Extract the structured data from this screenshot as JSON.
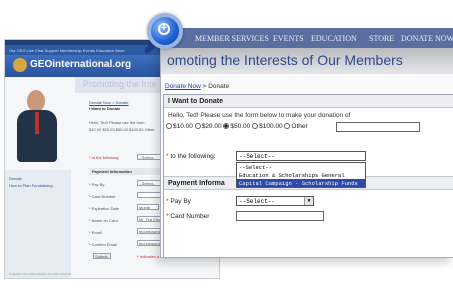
{
  "background_page": {
    "nav_text": "Our CEO Live Chat Support Membership Events Education Store",
    "logo_text": "GEOinternational.org",
    "title_text": "Promoting the Inte",
    "sidebar": [
      "Donate",
      "How to Plan Fundraising"
    ],
    "form": {
      "crumb": "Donate Now > Donate",
      "heading": "I Want to Donate",
      "greeting": "Hello, Ted! Please use the form",
      "amounts": "$10.00  $20.00  $50.00  $100.00  Other",
      "to_label": "* to the following:",
      "to_value": "--Select--",
      "payment_heading": "Payment Information",
      "fields": [
        {
          "label": "* Pay By",
          "value": "--Select--"
        },
        {
          "label": "* Card Number",
          "value": ""
        },
        {
          "label": "* Expiration Date",
          "value": "Month"
        },
        {
          "label": "* Name on Card",
          "value": "Mr. Ted Ericson"
        },
        {
          "label": "* Email",
          "value": "ted.ericson@..."
        },
        {
          "label": "* Confirm Email",
          "value": "ted.ericson@..."
        }
      ],
      "submit_label": "Submit",
      "required_note": "* Indicates a required field"
    },
    "footer": "Copyright Geo International. All rights reserved."
  },
  "main": {
    "nav_items": [
      "MEMBER SERVICES",
      "EVENTS",
      "EDUCATION",
      "STORE",
      "DONATE NOW"
    ],
    "title": "omoting the Interests of Our Members",
    "breadcrumb": {
      "link": "Donate Now",
      "separator": " > ",
      "current": "Donate"
    },
    "card_heading": "I Want to Donate",
    "greeting": "Hello, Ted! Please use the form below to make your donation of",
    "amount_options": [
      {
        "label": "$10.00",
        "selected": false
      },
      {
        "label": "$20.00",
        "selected": false
      },
      {
        "label": "$50.00",
        "selected": true
      },
      {
        "label": "$100.00",
        "selected": false
      },
      {
        "label": "Other",
        "selected": false
      }
    ],
    "to_label": "to the following:",
    "to_select_value": "--Select--",
    "to_options": [
      "--Select--",
      "Education & Scholarships General",
      "Capital Campaign - Scholarship Funds"
    ],
    "highlighted_option": "Capital Campaign - Scholarship Funds",
    "payment_heading": "Payment Informa",
    "pay_by_label": "Pay By",
    "pay_by_value": "--Select--",
    "card_number_label": "Card Number",
    "required_marker": "*"
  },
  "colors": {
    "nav_bg": "#5a6ea0",
    "title": "#2f4a8c",
    "link": "#1c3fa8",
    "highlight": "#2e4aa8",
    "magnifier": "#1d5fd3"
  },
  "icons": [
    "magnifier-zoom-icon",
    "dropdown-arrow-icon"
  ]
}
